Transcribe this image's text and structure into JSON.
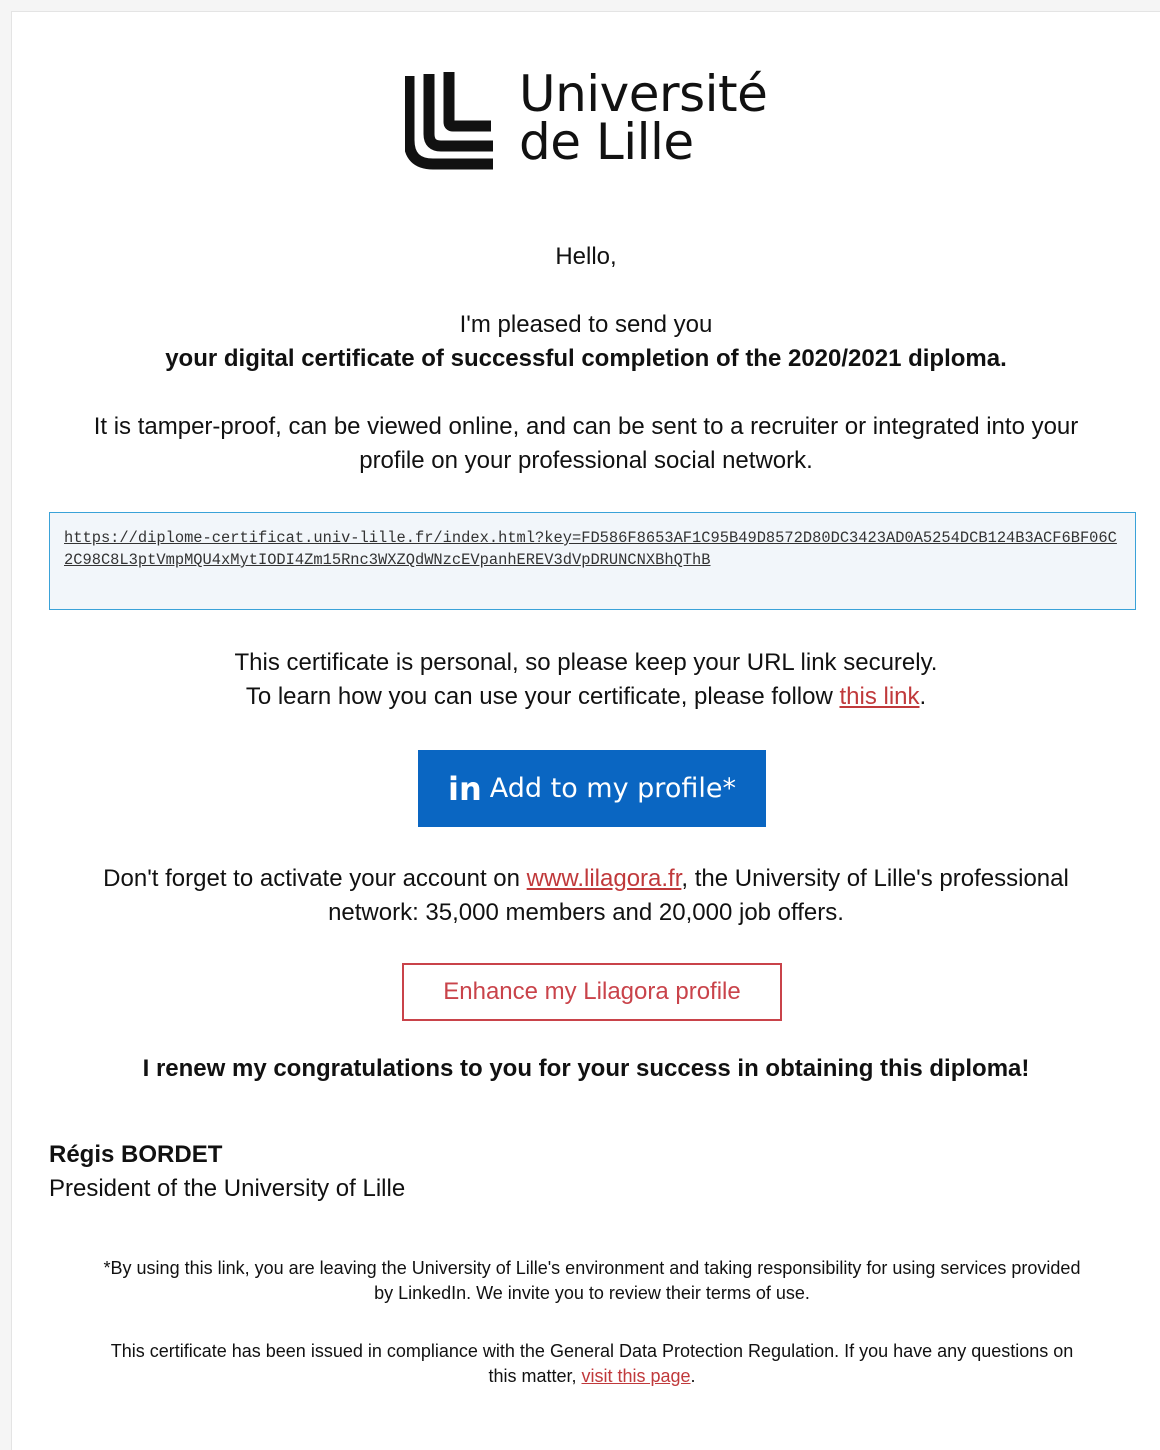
{
  "logo": {
    "line1": "Université",
    "line2": "de Lille"
  },
  "greeting": "Hello,",
  "intro": {
    "line1": "I'm pleased to send you",
    "line2": "your digital certificate of successful completion of the 2020/2021 diploma."
  },
  "description": {
    "line1": "It is tamper-proof, can be viewed online, and can be sent to a recruiter or integrated into your",
    "line2": "profile on your professional social network."
  },
  "certificate_url": "https://diplome-certificat.univ-lille.fr/index.html?key=FD586F8653AF1C95B49D8572D80DC3423AD0A5254DCB124B3ACF6BF06C2C98C8L3ptVmpMQU4xMytIODI4Zm15Rnc3WXZQdWNzcEVpanhEREV3dVpDRUNCNXBhQThB",
  "personal_note": {
    "line1": "This certificate is personal, so please keep your URL link securely.",
    "line2_prefix": "To learn how you can use your certificate, please follow ",
    "line2_link": "this link",
    "line2_suffix": "."
  },
  "linkedin_button": {
    "icon_text": "in",
    "label": "Add to my profile*"
  },
  "lilagora_note": {
    "line1_prefix": "Don't forget to activate your account on ",
    "line1_link": "www.lilagora.fr",
    "line1_suffix": ", the University of Lille's professional",
    "line2": "network: 35,000 members and 20,000 job offers."
  },
  "lilagora_button": {
    "label": "Enhance my Lilagora profile"
  },
  "congrats": "I renew my congratulations to you for your success in obtaining this diploma!",
  "signature": {
    "name": "Régis BORDET",
    "title": "President of the University of Lille"
  },
  "footnote1": {
    "line1": "*By using this link, you are leaving the University of Lille's environment and taking responsibility for using services provided",
    "line2": "by LinkedIn. We invite you to review their terms of use."
  },
  "footnote2": {
    "line1": "This certificate has been issued in compliance with the General Data Protection Regulation. If you have any questions on",
    "line2_prefix": "this matter, ",
    "line2_link": "visit this page",
    "line2_suffix": "."
  },
  "colors": {
    "linkedin": "#0a66c2",
    "accent_red": "#c9434a",
    "url_border": "#3aa2d8"
  }
}
